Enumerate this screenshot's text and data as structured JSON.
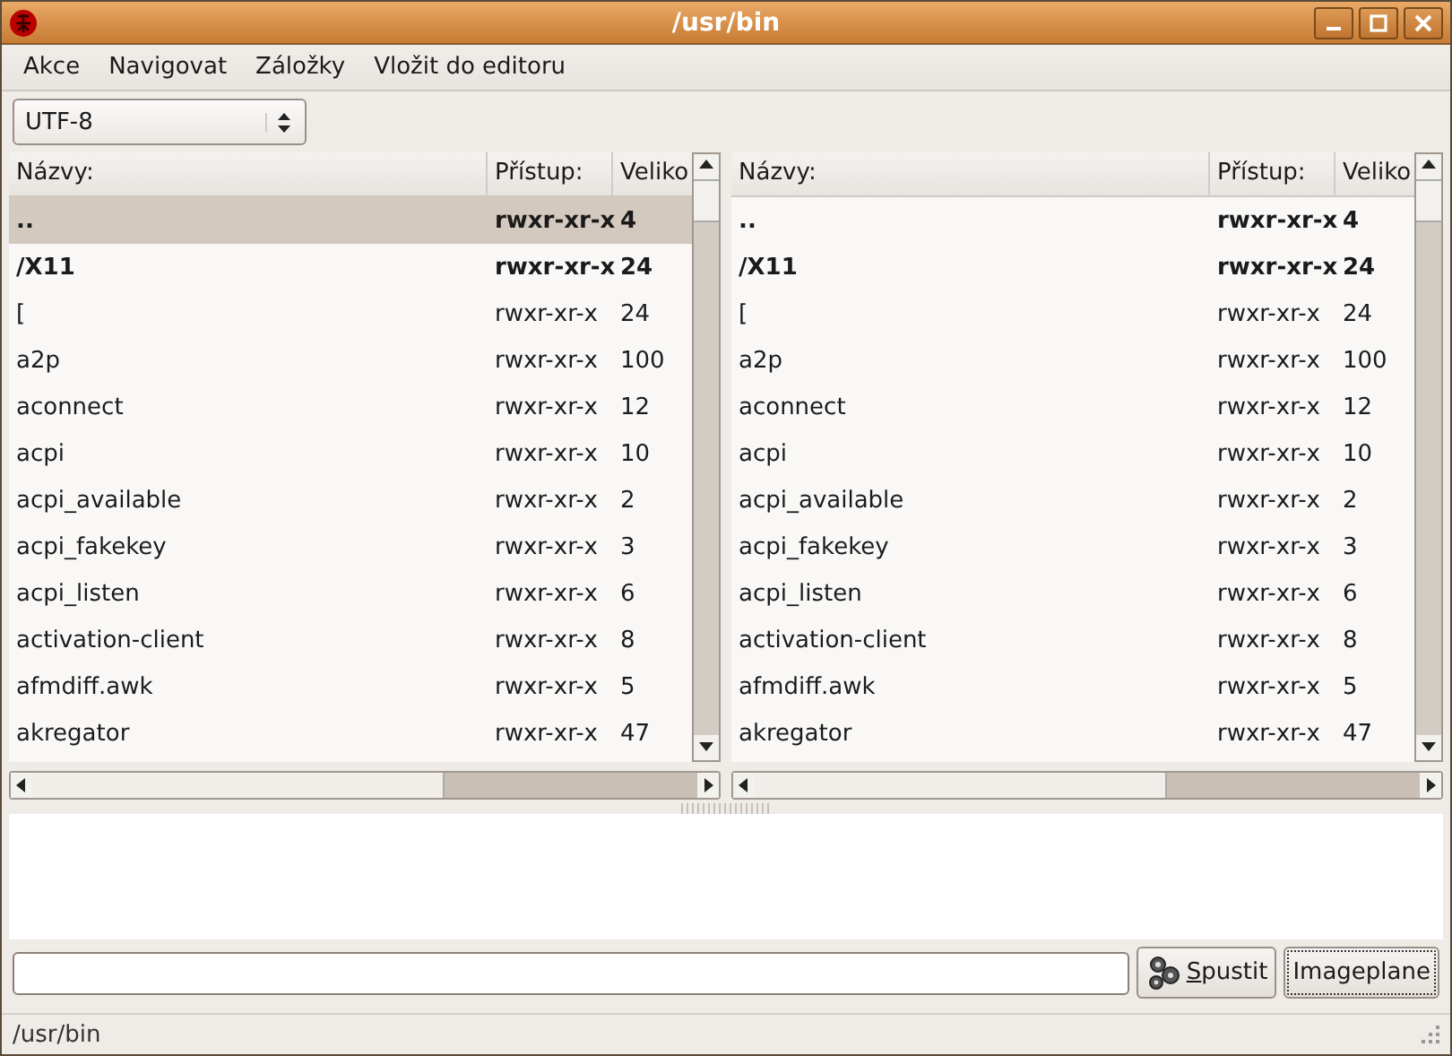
{
  "window": {
    "title": "/usr/bin"
  },
  "menu": [
    "Akce",
    "Navigovat",
    "Záložky",
    "Vložit do editoru"
  ],
  "encoding": {
    "value": "UTF-8"
  },
  "panels": [
    {
      "columns": [
        "Názvy:",
        "Přístup:",
        "Veliko"
      ],
      "rows": [
        {
          "name": "..",
          "access": "rwxr-xr-x",
          "size": "4",
          "kind": "dir",
          "selected": true
        },
        {
          "name": "/X11",
          "access": "rwxr-xr-x",
          "size": "24",
          "kind": "dir",
          "selected": false
        },
        {
          "name": "[",
          "access": "rwxr-xr-x",
          "size": "24",
          "kind": "file",
          "selected": false
        },
        {
          "name": "a2p",
          "access": "rwxr-xr-x",
          "size": "100",
          "kind": "file",
          "selected": false
        },
        {
          "name": "aconnect",
          "access": "rwxr-xr-x",
          "size": "12",
          "kind": "file",
          "selected": false
        },
        {
          "name": "acpi",
          "access": "rwxr-xr-x",
          "size": "10",
          "kind": "file",
          "selected": false
        },
        {
          "name": "acpi_available",
          "access": "rwxr-xr-x",
          "size": "2",
          "kind": "file",
          "selected": false
        },
        {
          "name": "acpi_fakekey",
          "access": "rwxr-xr-x",
          "size": "3",
          "kind": "file",
          "selected": false
        },
        {
          "name": "acpi_listen",
          "access": "rwxr-xr-x",
          "size": "6",
          "kind": "file",
          "selected": false
        },
        {
          "name": "activation-client",
          "access": "rwxr-xr-x",
          "size": "8",
          "kind": "file",
          "selected": false
        },
        {
          "name": "afmdiff.awk",
          "access": "rwxr-xr-x",
          "size": "5",
          "kind": "file",
          "selected": false
        },
        {
          "name": "akregator",
          "access": "rwxr-xr-x",
          "size": "47",
          "kind": "file",
          "selected": false
        }
      ]
    },
    {
      "columns": [
        "Názvy:",
        "Přístup:",
        "Veliko"
      ],
      "rows": [
        {
          "name": "..",
          "access": "rwxr-xr-x",
          "size": "4",
          "kind": "dir",
          "selected": false
        },
        {
          "name": "/X11",
          "access": "rwxr-xr-x",
          "size": "24",
          "kind": "dir",
          "selected": false
        },
        {
          "name": "[",
          "access": "rwxr-xr-x",
          "size": "24",
          "kind": "file",
          "selected": false
        },
        {
          "name": "a2p",
          "access": "rwxr-xr-x",
          "size": "100",
          "kind": "file",
          "selected": false
        },
        {
          "name": "aconnect",
          "access": "rwxr-xr-x",
          "size": "12",
          "kind": "file",
          "selected": false
        },
        {
          "name": "acpi",
          "access": "rwxr-xr-x",
          "size": "10",
          "kind": "file",
          "selected": false
        },
        {
          "name": "acpi_available",
          "access": "rwxr-xr-x",
          "size": "2",
          "kind": "file",
          "selected": false
        },
        {
          "name": "acpi_fakekey",
          "access": "rwxr-xr-x",
          "size": "3",
          "kind": "file",
          "selected": false
        },
        {
          "name": "acpi_listen",
          "access": "rwxr-xr-x",
          "size": "6",
          "kind": "file",
          "selected": false
        },
        {
          "name": "activation-client",
          "access": "rwxr-xr-x",
          "size": "8",
          "kind": "file",
          "selected": false
        },
        {
          "name": "afmdiff.awk",
          "access": "rwxr-xr-x",
          "size": "5",
          "kind": "file",
          "selected": false
        },
        {
          "name": "akregator",
          "access": "rwxr-xr-x",
          "size": "47",
          "kind": "file",
          "selected": false
        }
      ]
    }
  ],
  "buttons": [
    "Spustit",
    "Imageplane"
  ],
  "status_bar": "/usr/bin"
}
